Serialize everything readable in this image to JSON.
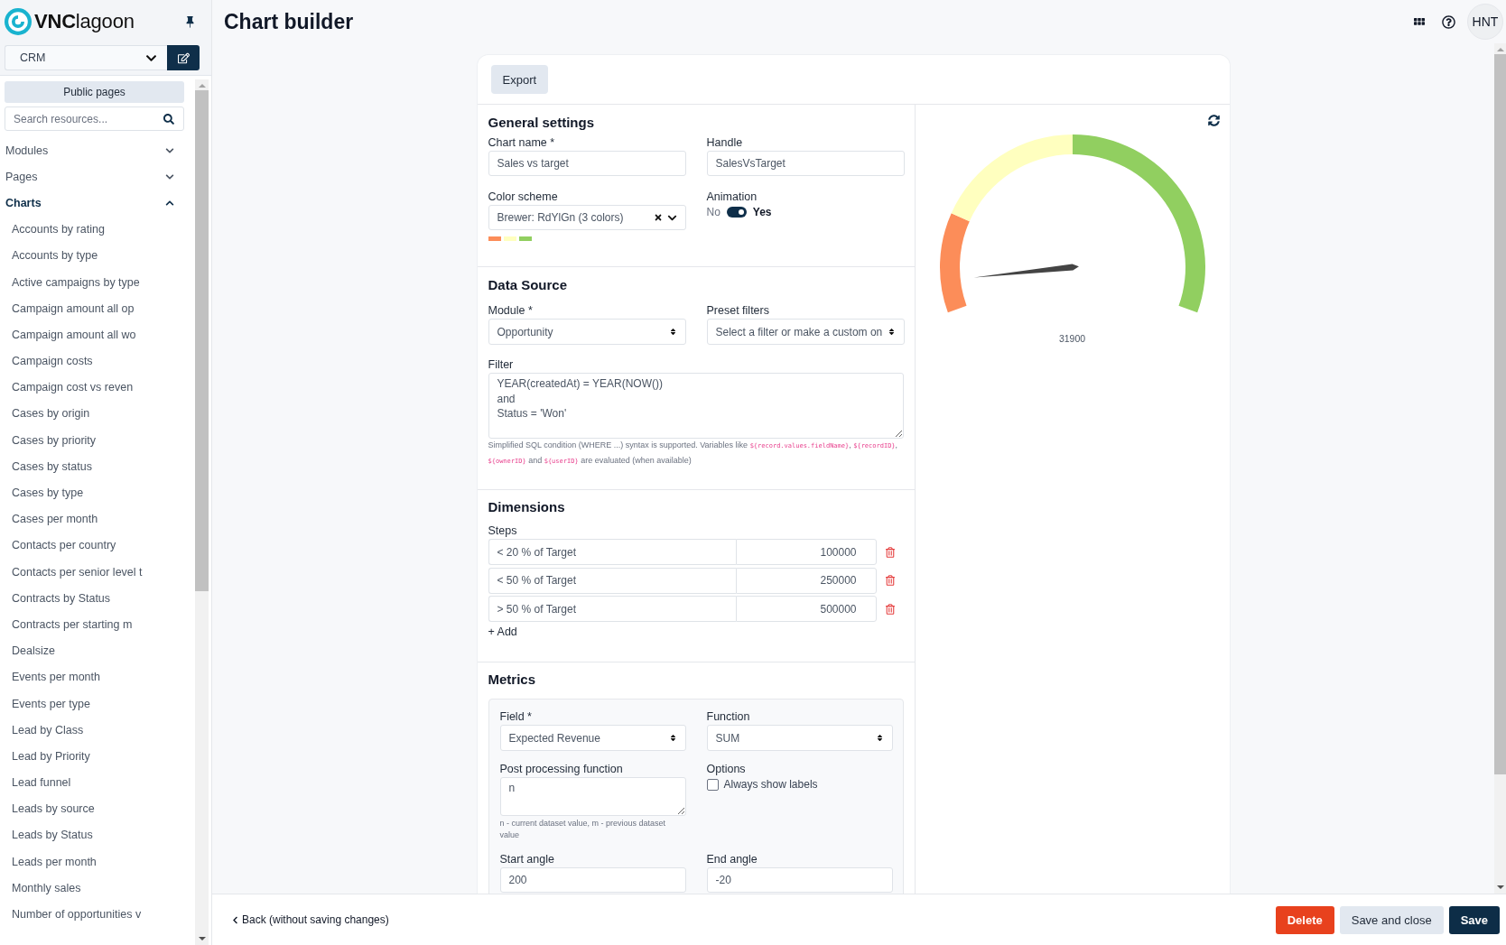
{
  "sidebar": {
    "brand": "**VNC**lagoon",
    "workspace": {
      "value": "CRM"
    },
    "public_pages": "Public pages",
    "search": {
      "placeholder": "Search resources..."
    },
    "sections": [
      {
        "label": "Modules",
        "expanded": false
      },
      {
        "label": "Pages",
        "expanded": false
      },
      {
        "label": "Charts",
        "expanded": true,
        "children": [
          {
            "label": "Accounts by rating"
          },
          {
            "label": "Accounts by type"
          },
          {
            "label": "Active campaigns by type"
          },
          {
            "label": "Campaign amount all op"
          },
          {
            "label": "Campaign amount all wo"
          },
          {
            "label": "Campaign costs"
          },
          {
            "label": "Campaign cost vs reven"
          },
          {
            "label": "Cases by origin"
          },
          {
            "label": "Cases by priority"
          },
          {
            "label": "Cases by status"
          },
          {
            "label": "Cases by type"
          },
          {
            "label": "Cases per month"
          },
          {
            "label": "Contacts per country"
          },
          {
            "label": "Contacts per senior level t"
          },
          {
            "label": "Contracts by Status"
          },
          {
            "label": "Contracts per starting m"
          },
          {
            "label": "Dealsize"
          },
          {
            "label": "Events per month"
          },
          {
            "label": "Events per type"
          },
          {
            "label": "Lead by Class"
          },
          {
            "label": "Lead by Priority"
          },
          {
            "label": "Lead funnel"
          },
          {
            "label": "Leads by source"
          },
          {
            "label": "Leads by Status"
          },
          {
            "label": "Leads per month"
          },
          {
            "label": "Monthly sales"
          },
          {
            "label": "Number of opportunities v"
          }
        ]
      }
    ]
  },
  "header": {
    "title": "Chart builder",
    "avatar": "HNT"
  },
  "card_toolbar": {
    "export": "Export"
  },
  "general_settings": {
    "title": "General settings",
    "chart_name": {
      "label": "Chart name *",
      "value": "Sales vs target"
    },
    "handle": {
      "label": "Handle",
      "value": "SalesVsTarget"
    },
    "color_scheme": {
      "label": "Color scheme",
      "value": "Brewer: RdYlGn (3 colors)",
      "swatches": [
        {
          "color": "#fc8d59"
        },
        {
          "color": "#ffffbf"
        },
        {
          "color": "#91cf60"
        }
      ]
    },
    "animation": {
      "label": "Animation",
      "off_label": "No",
      "on_label": "Yes",
      "on": true
    }
  },
  "data_source": {
    "title": "Data Source",
    "module": {
      "label": "Module *",
      "value": "Opportunity"
    },
    "preset_filters": {
      "label": "Preset filters",
      "placeholder": "Select a filter or make a custom on"
    },
    "filter": {
      "label": "Filter",
      "value": "YEAR(createdAt) = YEAR(NOW())\nand\nStatus = 'Won'",
      "help": [
        {
          "kind": "text",
          "text": "Simplified SQL condition (WHERE ...) syntax is supported. Variables like "
        },
        {
          "kind": "code",
          "text": "${record.values.fieldName}"
        },
        {
          "kind": "text",
          "text": ", "
        },
        {
          "kind": "code",
          "text": "${recordID}"
        },
        {
          "kind": "text",
          "text": ", "
        },
        {
          "kind": "code",
          "text": "${ownerID}"
        },
        {
          "kind": "text",
          "text": " and "
        },
        {
          "kind": "code",
          "text": "${userID}"
        },
        {
          "kind": "text",
          "text": " are evaluated (when available)"
        }
      ]
    }
  },
  "dimensions": {
    "title": "Dimensions",
    "steps_label": "Steps",
    "steps": [
      {
        "label": "< 20 % of Target",
        "value": "100000"
      },
      {
        "label": "< 50 % of Target",
        "value": "250000"
      },
      {
        "label": "> 50 % of Target",
        "value": "500000"
      }
    ],
    "add": "+ Add"
  },
  "metrics": {
    "title": "Metrics",
    "field": {
      "label": "Field *",
      "value": "Expected Revenue"
    },
    "function": {
      "label": "Function",
      "value": "SUM"
    },
    "post_processing": {
      "label": "Post processing function",
      "value": "n",
      "help": "n - current dataset value, m - previous dataset value"
    },
    "options": {
      "label": "Options",
      "always_show_labels": {
        "label": "Always show labels",
        "checked": false
      }
    },
    "start_angle": {
      "label": "Start angle",
      "value": "200"
    },
    "end_angle": {
      "label": "End angle",
      "value": "-20"
    }
  },
  "gauge": {
    "reading": "31900"
  },
  "footer": {
    "back": "Back (without saving changes)",
    "buttons": [
      {
        "label": "Delete",
        "kind": "danger"
      },
      {
        "label": "Save and close",
        "kind": "secondary"
      },
      {
        "label": "Save",
        "kind": "primary"
      }
    ]
  }
}
